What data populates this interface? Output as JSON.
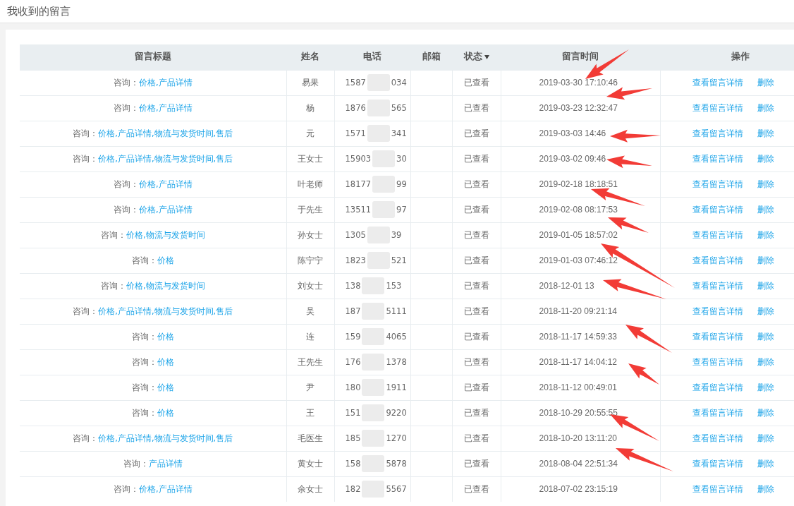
{
  "page_title": "我收到的留言",
  "table": {
    "columns": [
      {
        "label": "留言标题",
        "sortable": false
      },
      {
        "label": "姓名",
        "sortable": false
      },
      {
        "label": "电话",
        "sortable": false
      },
      {
        "label": "邮箱",
        "sortable": false
      },
      {
        "label": "状态",
        "sortable": true
      },
      {
        "label": "留言时间",
        "sortable": false
      },
      {
        "label": "操作",
        "sortable": false
      }
    ],
    "rows": [
      {
        "prefix": "咨询：",
        "topics": "价格,产品详情",
        "name": "易果",
        "phone_start": "1587",
        "phone_end": "034",
        "status": "已查看",
        "time": "2019-03-30 17:10:46",
        "view": "查看留言详情",
        "delete": "删除"
      },
      {
        "prefix": "咨询：",
        "topics": "价格,产品详情",
        "name": "杨",
        "phone_start": "1876",
        "phone_end": "565",
        "status": "已查看",
        "time": "2019-03-23 12:32:47",
        "view": "查看留言详情",
        "delete": "删除"
      },
      {
        "prefix": "咨询：",
        "topics": "价格,产品详情,物流与发货时间,售后",
        "name": "元",
        "phone_start": "1571",
        "phone_end": "341",
        "status": "已查看",
        "time": "2019-03-03 14:46",
        "view": "查看留言详情",
        "delete": "删除"
      },
      {
        "prefix": "咨询：",
        "topics": "价格,产品详情,物流与发货时间,售后",
        "name": "王女士",
        "phone_start": "15903",
        "phone_end": "30",
        "status": "已查看",
        "time": "2019-03-02 09:46",
        "view": "查看留言详情",
        "delete": "删除"
      },
      {
        "prefix": "咨询：",
        "topics": "价格,产品详情",
        "name": "叶老师",
        "phone_start": "18177",
        "phone_end": "99",
        "status": "已查看",
        "time": "2019-02-18 18:18:51",
        "view": "查看留言详情",
        "delete": "删除"
      },
      {
        "prefix": "咨询：",
        "topics": "价格,产品详情",
        "name": "于先生",
        "phone_start": "13511",
        "phone_end": "97",
        "status": "已查看",
        "time": "2019-02-08 08:17:53",
        "view": "查看留言详情",
        "delete": "删除"
      },
      {
        "prefix": "咨询：",
        "topics": "价格,物流与发货时间",
        "name": "孙女士",
        "phone_start": "1305",
        "phone_end": "39",
        "status": "已查看",
        "time": "2019-01-05 18:57:02",
        "view": "查看留言详情",
        "delete": "删除"
      },
      {
        "prefix": "咨询：",
        "topics": "价格",
        "name": "陈宁宁",
        "phone_start": "1823",
        "phone_end": "521",
        "status": "已查看",
        "time": "2019-01-03 07:46:12",
        "view": "查看留言详情",
        "delete": "删除"
      },
      {
        "prefix": "咨询：",
        "topics": "价格,物流与发货时间",
        "name": "刘女士",
        "phone_start": "138",
        "phone_end": "153",
        "status": "已查看",
        "time": "2018-12-01 13",
        "view": "查看留言详情",
        "delete": "删除"
      },
      {
        "prefix": "咨询：",
        "topics": "价格,产品详情,物流与发货时间,售后",
        "name": "吴",
        "phone_start": "187",
        "phone_end": "5111",
        "status": "已查看",
        "time": "2018-11-20 09:21:14",
        "view": "查看留言详情",
        "delete": "删除"
      },
      {
        "prefix": "咨询：",
        "topics": "价格",
        "name": "连",
        "phone_start": "159",
        "phone_end": "4065",
        "status": "已查看",
        "time": "2018-11-17 14:59:33",
        "view": "查看留言详情",
        "delete": "删除"
      },
      {
        "prefix": "咨询：",
        "topics": "价格",
        "name": "王先生",
        "phone_start": "176",
        "phone_end": "1378",
        "status": "已查看",
        "time": "2018-11-17 14:04:12",
        "view": "查看留言详情",
        "delete": "删除"
      },
      {
        "prefix": "咨询：",
        "topics": "价格",
        "name": "尹",
        "phone_start": "180",
        "phone_end": "1911",
        "status": "已查看",
        "time": "2018-11-12 00:49:01",
        "view": "查看留言详情",
        "delete": "删除"
      },
      {
        "prefix": "咨询：",
        "topics": "价格",
        "name": "王",
        "phone_start": "151",
        "phone_end": "9220",
        "status": "已查看",
        "time": "2018-10-29 20:55:55",
        "view": "查看留言详情",
        "delete": "删除"
      },
      {
        "prefix": "咨询：",
        "topics": "价格,产品详情,物流与发货时间,售后",
        "name": "毛医生",
        "phone_start": "185",
        "phone_end": "1270",
        "status": "已查看",
        "time": "2018-10-20 13:11:20",
        "view": "查看留言详情",
        "delete": "删除"
      },
      {
        "prefix": "咨询：",
        "topics": "产品详情",
        "name": "黄女士",
        "phone_start": "158",
        "phone_end": "5878",
        "status": "已查看",
        "time": "2018-08-04 22:51:34",
        "view": "查看留言详情",
        "delete": "删除"
      },
      {
        "prefix": "咨询：",
        "topics": "价格,产品详情",
        "name": "余女士",
        "phone_start": "182",
        "phone_end": "5567",
        "status": "已查看",
        "time": "2018-07-02 23:15:19",
        "view": "查看留言详情",
        "delete": "删除"
      }
    ]
  }
}
